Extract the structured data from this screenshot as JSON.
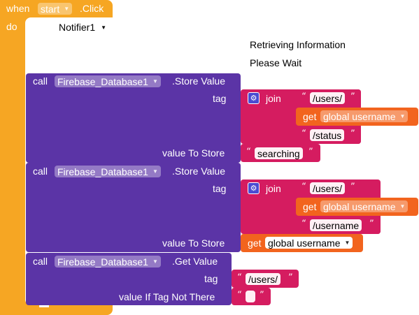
{
  "event": {
    "when": "when",
    "component": "start",
    "event_name": ".Click",
    "do": "do"
  },
  "notifier": {
    "component": "Notifier1"
  },
  "notifier_text": {
    "line1": "Retrieving Information",
    "line2": "Please Wait"
  },
  "store1": {
    "call": "call",
    "component": "Firebase_Database1",
    "method": ".Store Value",
    "tag_label": "tag",
    "join": "join",
    "part1": "/users/",
    "var_get": "get",
    "var_name": "global username",
    "part3": "/status",
    "value_label": "value To Store",
    "value": "searching"
  },
  "store2": {
    "call": "call",
    "component": "Firebase_Database1",
    "method": ".Store Value",
    "tag_label": "tag",
    "join": "join",
    "part1": "/users/",
    "var_get": "get",
    "var_name": "global username",
    "part3": "/username",
    "value_label": "value To Store",
    "value_get": "get",
    "value_var": "global username"
  },
  "getval": {
    "call": "call",
    "component": "Firebase_Database1",
    "method": ".Get Value",
    "tag_label": "tag",
    "tag_value": "/users/",
    "default_label": "value If Tag Not There",
    "default_value": ""
  },
  "colors": {
    "event": "#f6a623",
    "firebase": "#5b34a6",
    "text": "#d51c60",
    "variable": "#f2641e",
    "join_gear": "#4b4bd2"
  }
}
